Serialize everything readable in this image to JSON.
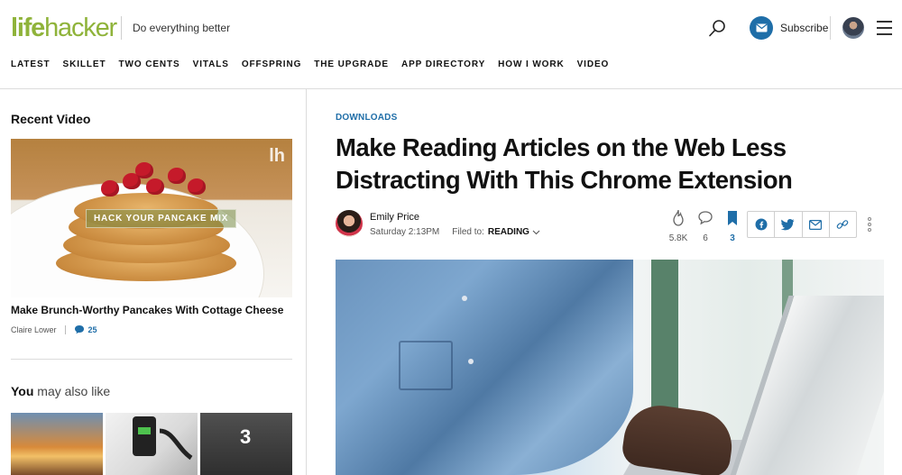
{
  "header": {
    "logo_life": "life",
    "logo_hacker": "hacker",
    "tagline": "Do everything better",
    "subscribe_label": "Subscribe",
    "icons": [
      "search-icon",
      "mail-icon",
      "user-avatar",
      "hamburger-menu-icon"
    ]
  },
  "nav": {
    "items": [
      "LATEST",
      "SKILLET",
      "TWO CENTS",
      "VITALS",
      "OFFSPRING",
      "THE UPGRADE",
      "APP DIRECTORY",
      "HOW I WORK",
      "VIDEO"
    ]
  },
  "sidebar": {
    "recent_video_heading": "Recent Video",
    "video": {
      "overlay_text": "HACK YOUR PANCAKE MIX",
      "title": "Make Brunch-Worthy Pancakes With Cottage Cheese",
      "author": "Claire Lower",
      "comments": "25"
    },
    "ymal_bold": "You",
    "ymal_rest": " may also like",
    "thumb3_number": "3"
  },
  "article": {
    "kicker": "DOWNLOADS",
    "headline": "Make Reading Articles on the Web Less Distracting With This Chrome Extension",
    "author": "Emily Price",
    "timestamp": "Saturday 2:13PM",
    "filed_to_label": "Filed to:",
    "filed_to_tag": "READING",
    "stats": {
      "views": "5.8K",
      "comments": "6",
      "saves": "3"
    },
    "share_icons": [
      "facebook-icon",
      "twitter-icon",
      "email-icon",
      "link-icon"
    ]
  },
  "colors": {
    "brand_green": "#8fb33a",
    "link_blue": "#1f6ea8"
  }
}
